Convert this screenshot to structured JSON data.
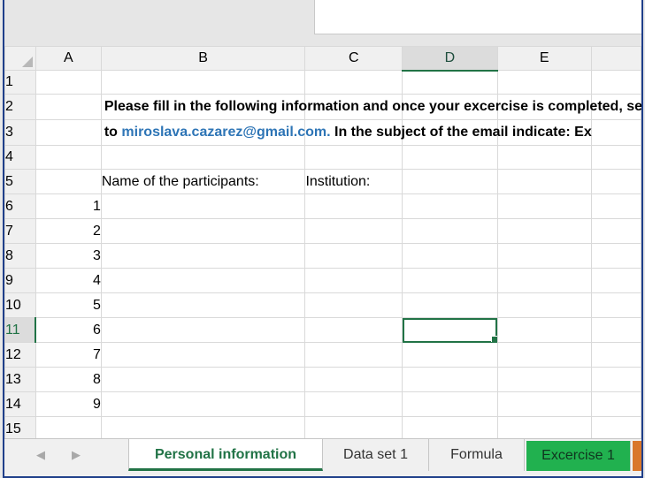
{
  "columns": [
    "A",
    "B",
    "C",
    "D",
    "E"
  ],
  "rows": [
    "1",
    "2",
    "3",
    "4",
    "5",
    "6",
    "7",
    "8",
    "9",
    "10",
    "11",
    "12",
    "13",
    "14",
    "15"
  ],
  "cells": {
    "b2": "Please fill in the following information and once your excercise is completed, send it",
    "b3_prefix": "to ",
    "b3_email": "miroslava.cazarez@gmail.com.",
    "b3_suffix": " In the subject of the email indicate: Ex",
    "b5": "Name of the participants:",
    "c5": "Institution:",
    "a_numbers": [
      "1",
      "2",
      "3",
      "4",
      "5",
      "6",
      "7",
      "8",
      "9"
    ]
  },
  "selected_cell": "D11",
  "sheet_tabs": {
    "nav_prev": "◀",
    "nav_next": "▶",
    "tabs": [
      {
        "label": "Personal information",
        "state": "active"
      },
      {
        "label": "Data set 1",
        "state": "normal"
      },
      {
        "label": "Formula",
        "state": "normal"
      },
      {
        "label": "Excercise 1",
        "state": "green"
      },
      {
        "label": "",
        "state": "orange"
      }
    ]
  },
  "colors": {
    "accent": "#217346",
    "email": "#2e75b6",
    "tab_green": "#21b14f",
    "tab_orange": "#d9772b"
  }
}
